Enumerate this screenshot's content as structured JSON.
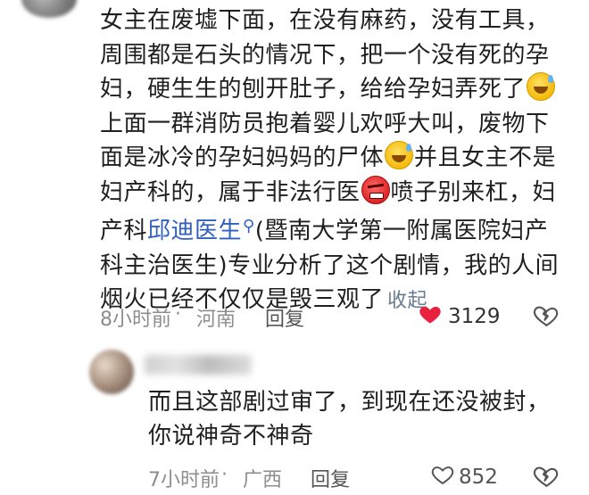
{
  "comment": {
    "lines": [
      "女主在废墟下面，在没有麻药，没有工具，",
      "周围都是石头的情况下，把一个没有死的孕",
      "妇，硬生生的刨开肚子，给给孕妇弄死了",
      "上面一群消防员抱着婴儿欢呼大叫，废物下",
      "面是冰冷的孕妇妈妈的尸体",
      "并且女主不是",
      "妇产科的，属于非法行医",
      "喷子别来杠，妇",
      "产科",
      "邱迪医生",
      "(暨南大学第一附属医院妇产",
      "科主治医生)专业分析了这个剧情，我的人间",
      "烟火已经不仅仅是毁三观了"
    ],
    "collapse_label": "收起",
    "time": "8小时前",
    "dot": "·",
    "location": "河南",
    "reply_label": "回复",
    "like_count": "3129",
    "like_color": "#e8213f"
  },
  "reply": {
    "lines": [
      "而且这部剧过审了，到现在还没被封，",
      "你说神奇不神奇"
    ],
    "time": "7小时前",
    "dot": "·",
    "location": "广西",
    "reply_label": "回复",
    "like_count": "852"
  },
  "icons": {
    "like_filled": "heart-filled-icon",
    "like_outline": "heart-outline-icon",
    "dislike": "broken-heart-icon",
    "mention": "search-icon",
    "emoji_sweat": "sweat-smile-emoji",
    "emoji_angry": "angry-face-emoji"
  }
}
